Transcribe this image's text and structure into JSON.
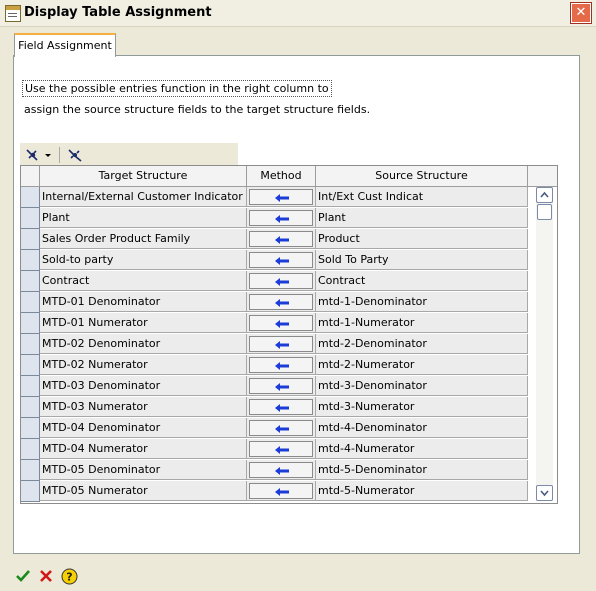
{
  "window": {
    "title": "Display Table Assignment",
    "close_icon": "close-icon"
  },
  "tab": {
    "label": "Field Assignment"
  },
  "info": {
    "line1": "Use the possible entries function in the right column to",
    "line2": "assign the source structure fields to the target structure fields."
  },
  "toolbar": {
    "items": [
      "link-dropdown-icon",
      "unlink-icon"
    ]
  },
  "table": {
    "headers": {
      "target": "Target Structure",
      "method": "Method",
      "source": "Source Structure"
    },
    "method_icon": "arrow-left-icon",
    "rows": [
      {
        "target": "Internal/External Customer Indicator",
        "source": "Int/Ext Cust Indicat"
      },
      {
        "target": " Plant",
        "source": "Plant"
      },
      {
        "target": "Sales Order Product Family",
        "source": "Product"
      },
      {
        "target": "Sold-to party",
        "source": "Sold To Party"
      },
      {
        "target": "Contract",
        "source": "Contract"
      },
      {
        "target": "MTD-01 Denominator",
        "source": "mtd-1-Denominator"
      },
      {
        "target": "MTD-01 Numerator",
        "source": "mtd-1-Numerator"
      },
      {
        "target": "MTD-02 Denominator",
        "source": "mtd-2-Denominator"
      },
      {
        "target": "MTD-02 Numerator",
        "source": "mtd-2-Numerator"
      },
      {
        "target": "MTD-03 Denominator",
        "source": "mtd-3-Denominator"
      },
      {
        "target": "MTD-03 Numerator",
        "source": "mtd-3-Numerator"
      },
      {
        "target": "MTD-04 Denominator",
        "source": "mtd-4-Denominator"
      },
      {
        "target": "MTD-04 Numerator",
        "source": "mtd-4-Numerator"
      },
      {
        "target": "MTD-05 Denominator",
        "source": "mtd-5-Denominator"
      },
      {
        "target": "MTD-05 Numerator",
        "source": "mtd-5-Numerator"
      }
    ]
  },
  "footer": {
    "buttons": [
      "check-icon",
      "cancel-icon",
      "help-icon"
    ]
  },
  "colors": {
    "accent": "#f5b040",
    "arrow": "#1c3cd8",
    "close": "#e46a4a"
  }
}
